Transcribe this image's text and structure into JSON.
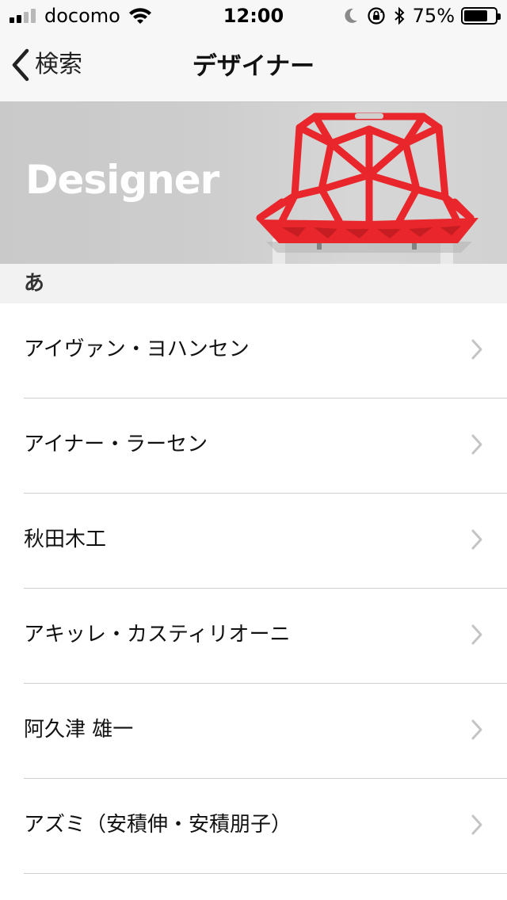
{
  "status_bar": {
    "carrier": "docomo",
    "time": "12:00",
    "battery_percent": "75%",
    "battery_level": 0.75,
    "icons": [
      "signal-icon",
      "wifi-icon",
      "moon-icon",
      "rotation-lock-icon",
      "bluetooth-icon",
      "battery-icon"
    ]
  },
  "nav": {
    "back_label": "検索",
    "title": "デザイナー"
  },
  "banner": {
    "title": "Designer",
    "image": "red-chair-image"
  },
  "section": {
    "header": "あ"
  },
  "designers": [
    {
      "name": "アイヴァン・ヨハンセン"
    },
    {
      "name": "アイナー・ラーセン"
    },
    {
      "name": "秋田木工"
    },
    {
      "name": "アキッレ・カスティリオーニ"
    },
    {
      "name": "阿久津 雄一"
    },
    {
      "name": "アズミ（安積伸・安積朋子）"
    }
  ],
  "colors": {
    "bar_background": "#f7f7f7",
    "chair_red": "#e8262b",
    "section_background": "#f2f2f2",
    "chevron": "#c4c4c7"
  }
}
